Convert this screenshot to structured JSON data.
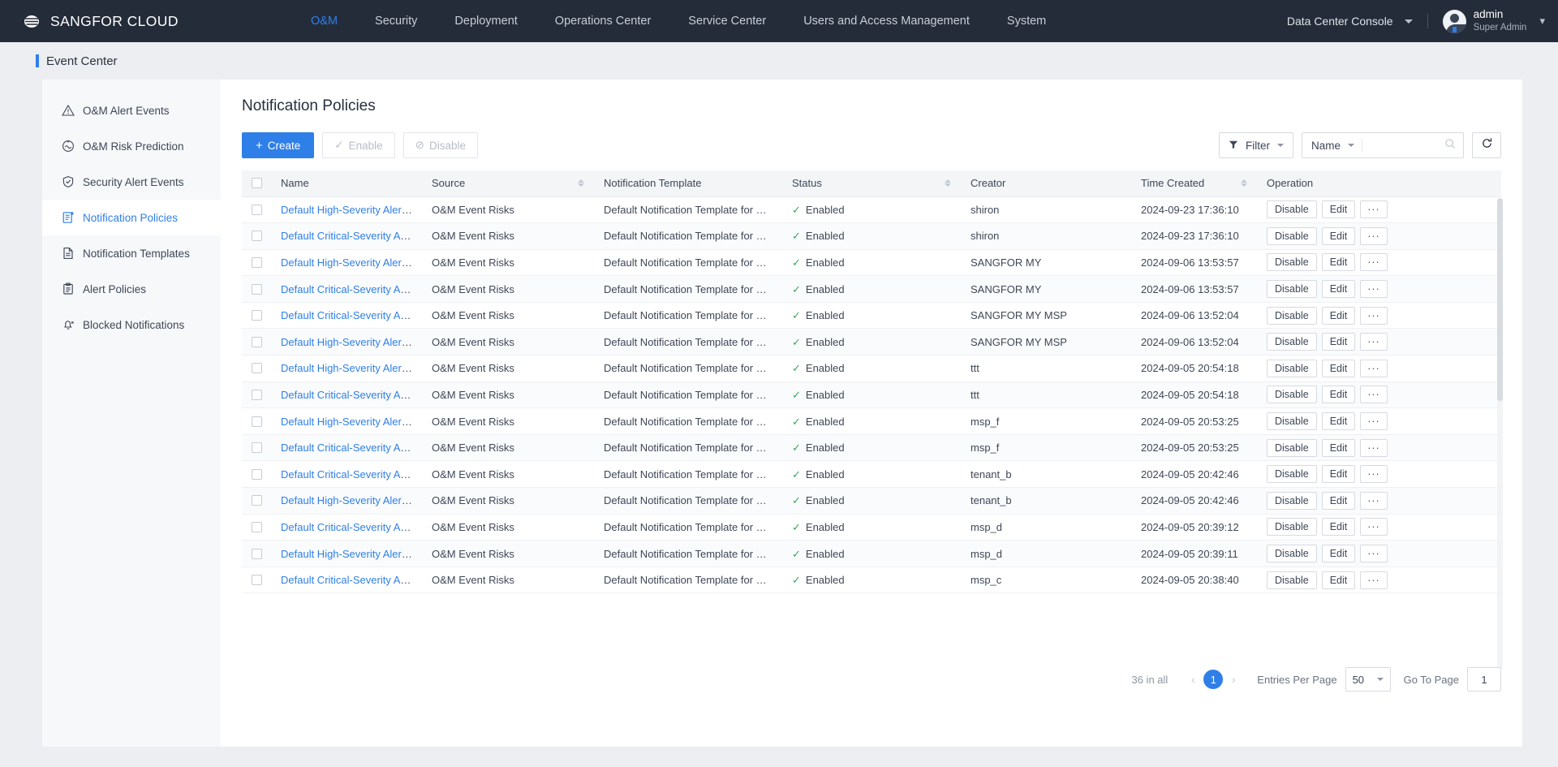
{
  "topnav": {
    "brand": "SANGFOR CLOUD",
    "items": [
      {
        "label": "O&M",
        "active": true
      },
      {
        "label": "Security",
        "active": false
      },
      {
        "label": "Deployment",
        "active": false
      },
      {
        "label": "Operations Center",
        "active": false
      },
      {
        "label": "Service Center",
        "active": false
      },
      {
        "label": "Users and Access Management",
        "active": false
      },
      {
        "label": "System",
        "active": false
      }
    ],
    "console_selector": "Data Center Console",
    "user_name": "admin",
    "user_role": "Super Admin"
  },
  "page_header": {
    "title": "Event Center"
  },
  "sidebar": {
    "items": [
      {
        "label": "O&M Alert Events",
        "icon": "warning-triangle-icon",
        "active": false
      },
      {
        "label": "O&M Risk Prediction",
        "icon": "risk-prediction-icon",
        "active": false
      },
      {
        "label": "Security Alert Events",
        "icon": "shield-check-icon",
        "active": false
      },
      {
        "label": "Notification Policies",
        "icon": "notification-policy-icon",
        "active": true
      },
      {
        "label": "Notification Templates",
        "icon": "document-icon",
        "active": false
      },
      {
        "label": "Alert Policies",
        "icon": "clipboard-icon",
        "active": false
      },
      {
        "label": "Blocked Notifications",
        "icon": "muted-bell-icon",
        "active": false
      }
    ]
  },
  "main": {
    "title": "Notification Policies",
    "toolbar": {
      "create_label": "Create",
      "enable_label": "Enable",
      "disable_label": "Disable",
      "filter_label": "Filter",
      "search_field": "Name",
      "search_value": "",
      "search_placeholder": ""
    },
    "columns": [
      {
        "key": "name",
        "label": "Name",
        "sortable": false
      },
      {
        "key": "source",
        "label": "Source",
        "sortable": true
      },
      {
        "key": "template",
        "label": "Notification Template",
        "sortable": false
      },
      {
        "key": "status",
        "label": "Status",
        "sortable": true
      },
      {
        "key": "creator",
        "label": "Creator",
        "sortable": false
      },
      {
        "key": "time",
        "label": "Time Created",
        "sortable": true
      },
      {
        "key": "operation",
        "label": "Operation",
        "sortable": false
      }
    ],
    "row_actions": {
      "disable": "Disable",
      "edit": "Edit",
      "more": "···"
    },
    "rows": [
      {
        "name": "Default High-Severity Alert Policy",
        "source": "O&M Event Risks",
        "template": "Default Notification Template for High-S...",
        "status": "Enabled",
        "creator": "shiron",
        "time": "2024-09-23 17:36:10"
      },
      {
        "name": "Default Critical-Severity Alert Policy",
        "source": "O&M Event Risks",
        "template": "Default Notification Template for Critical...",
        "status": "Enabled",
        "creator": "shiron",
        "time": "2024-09-23 17:36:10"
      },
      {
        "name": "Default High-Severity Alert Policy",
        "source": "O&M Event Risks",
        "template": "Default Notification Template for High-S...",
        "status": "Enabled",
        "creator": "SANGFOR MY",
        "time": "2024-09-06 13:53:57"
      },
      {
        "name": "Default Critical-Severity Alert Policy",
        "source": "O&M Event Risks",
        "template": "Default Notification Template for Critical...",
        "status": "Enabled",
        "creator": "SANGFOR MY",
        "time": "2024-09-06 13:53:57"
      },
      {
        "name": "Default Critical-Severity Alert Policy",
        "source": "O&M Event Risks",
        "template": "Default Notification Template for Critical...",
        "status": "Enabled",
        "creator": "SANGFOR MY MSP",
        "time": "2024-09-06 13:52:04"
      },
      {
        "name": "Default High-Severity Alert Policy",
        "source": "O&M Event Risks",
        "template": "Default Notification Template for High-S...",
        "status": "Enabled",
        "creator": "SANGFOR MY MSP",
        "time": "2024-09-06 13:52:04"
      },
      {
        "name": "Default High-Severity Alert Policy",
        "source": "O&M Event Risks",
        "template": "Default Notification Template for High-S...",
        "status": "Enabled",
        "creator": "ttt",
        "time": "2024-09-05 20:54:18"
      },
      {
        "name": "Default Critical-Severity Alert Policy",
        "source": "O&M Event Risks",
        "template": "Default Notification Template for Critical...",
        "status": "Enabled",
        "creator": "ttt",
        "time": "2024-09-05 20:54:18"
      },
      {
        "name": "Default High-Severity Alert Policy",
        "source": "O&M Event Risks",
        "template": "Default Notification Template for High-S...",
        "status": "Enabled",
        "creator": "msp_f",
        "time": "2024-09-05 20:53:25"
      },
      {
        "name": "Default Critical-Severity Alert Policy",
        "source": "O&M Event Risks",
        "template": "Default Notification Template for Critical...",
        "status": "Enabled",
        "creator": "msp_f",
        "time": "2024-09-05 20:53:25"
      },
      {
        "name": "Default Critical-Severity Alert Policy",
        "source": "O&M Event Risks",
        "template": "Default Notification Template for Critical...",
        "status": "Enabled",
        "creator": "tenant_b",
        "time": "2024-09-05 20:42:46"
      },
      {
        "name": "Default High-Severity Alert Policy",
        "source": "O&M Event Risks",
        "template": "Default Notification Template for High-S...",
        "status": "Enabled",
        "creator": "tenant_b",
        "time": "2024-09-05 20:42:46"
      },
      {
        "name": "Default Critical-Severity Alert Policy",
        "source": "O&M Event Risks",
        "template": "Default Notification Template for Critical...",
        "status": "Enabled",
        "creator": "msp_d",
        "time": "2024-09-05 20:39:12"
      },
      {
        "name": "Default High-Severity Alert Policy",
        "source": "O&M Event Risks",
        "template": "Default Notification Template for High-S...",
        "status": "Enabled",
        "creator": "msp_d",
        "time": "2024-09-05 20:39:11"
      },
      {
        "name": "Default Critical-Severity Alert Policy",
        "source": "O&M Event Risks",
        "template": "Default Notification Template for Critical...",
        "status": "Enabled",
        "creator": "msp_c",
        "time": "2024-09-05 20:38:40"
      }
    ],
    "pagination": {
      "total_label": "36 in all",
      "current_page": "1",
      "entries_label": "Entries Per Page",
      "entries_per_page": "50",
      "goto_label": "Go To Page",
      "goto_value": "1"
    }
  },
  "colors": {
    "accent": "#2f7fe8",
    "navbar": "#242c3a",
    "status_ok": "#3aa757",
    "page_bg": "#eceef1"
  }
}
